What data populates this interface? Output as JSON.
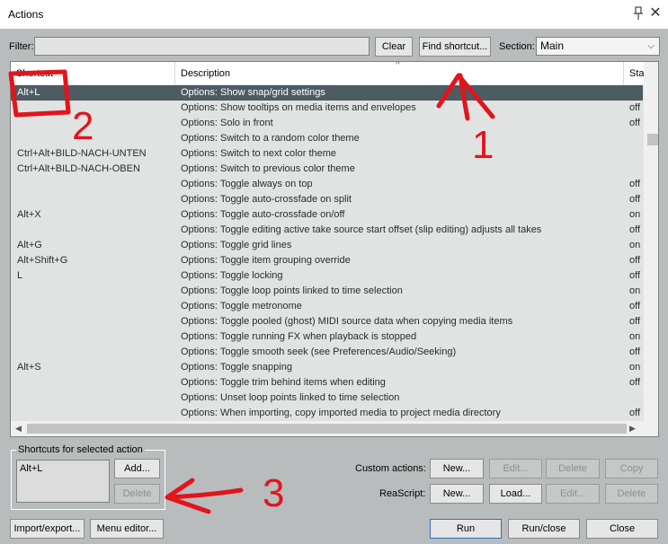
{
  "window": {
    "title": "Actions",
    "pin_icon": "pin-icon",
    "close_glyph": "✕"
  },
  "toolbar": {
    "filter_label": "Filter:",
    "filter_value": "",
    "clear_label": "Clear",
    "find_shortcut_label": "Find shortcut...",
    "section_label": "Section:",
    "section_value": "Main"
  },
  "table": {
    "columns": [
      "Shortcut",
      "Description",
      "Sta"
    ],
    "rows": [
      {
        "shortcut": "Alt+L",
        "description": "Options: Show snap/grid settings",
        "state": "",
        "selected": true
      },
      {
        "shortcut": "",
        "description": "Options: Show tooltips on media items and envelopes",
        "state": "off"
      },
      {
        "shortcut": "",
        "description": "Options: Solo in front",
        "state": "off"
      },
      {
        "shortcut": "",
        "description": "Options: Switch to a random color theme",
        "state": ""
      },
      {
        "shortcut": "Ctrl+Alt+BILD-NACH-UNTEN",
        "description": "Options: Switch to next color theme",
        "state": ""
      },
      {
        "shortcut": "Ctrl+Alt+BILD-NACH-OBEN",
        "description": "Options: Switch to previous color theme",
        "state": ""
      },
      {
        "shortcut": "",
        "description": "Options: Toggle always on top",
        "state": "off"
      },
      {
        "shortcut": "",
        "description": "Options: Toggle auto-crossfade on split",
        "state": "off"
      },
      {
        "shortcut": "Alt+X",
        "description": "Options: Toggle auto-crossfade on/off",
        "state": "on"
      },
      {
        "shortcut": "",
        "description": "Options: Toggle editing active take source start offset (slip editing) adjusts all takes",
        "state": "off"
      },
      {
        "shortcut": "Alt+G",
        "description": "Options: Toggle grid lines",
        "state": "on"
      },
      {
        "shortcut": "Alt+Shift+G",
        "description": "Options: Toggle item grouping override",
        "state": "off"
      },
      {
        "shortcut": "L",
        "description": "Options: Toggle locking",
        "state": "off"
      },
      {
        "shortcut": "",
        "description": "Options: Toggle loop points linked to time selection",
        "state": "on"
      },
      {
        "shortcut": "",
        "description": "Options: Toggle metronome",
        "state": "off"
      },
      {
        "shortcut": "",
        "description": "Options: Toggle pooled (ghost) MIDI source data when copying media items",
        "state": "off"
      },
      {
        "shortcut": "",
        "description": "Options: Toggle running FX when playback is stopped",
        "state": "on"
      },
      {
        "shortcut": "",
        "description": "Options: Toggle smooth seek (see Preferences/Audio/Seeking)",
        "state": "off"
      },
      {
        "shortcut": "Alt+S",
        "description": "Options: Toggle snapping",
        "state": "on"
      },
      {
        "shortcut": "",
        "description": "Options: Toggle trim behind items when editing",
        "state": "off"
      },
      {
        "shortcut": "",
        "description": "Options: Unset loop points linked to time selection",
        "state": ""
      },
      {
        "shortcut": "",
        "description": "Options: When importing, copy imported media to project media directory",
        "state": "off"
      }
    ]
  },
  "shortcuts_group": {
    "legend": "Shortcuts for selected action",
    "value": "Alt+L",
    "add_label": "Add...",
    "delete_label": "Delete"
  },
  "custom_actions": {
    "label": "Custom actions:",
    "new_label": "New...",
    "edit_label": "Edit...",
    "delete_label": "Delete",
    "copy_label": "Copy"
  },
  "reascript": {
    "label": "ReaScript:",
    "new_label": "New...",
    "load_label": "Load...",
    "edit_label": "Edit...",
    "delete_label": "Delete"
  },
  "footer": {
    "import_export_label": "Import/export...",
    "menu_editor_label": "Menu editor...",
    "run_label": "Run",
    "run_close_label": "Run/close",
    "close_label": "Close"
  },
  "annotations": {
    "one": "1",
    "two": "2",
    "three": "3",
    "color": "#e3141b"
  },
  "colors": {
    "selected_row": "#4d5b63",
    "background": "#b9bcbd",
    "list_bg": "#e1e3e3"
  }
}
